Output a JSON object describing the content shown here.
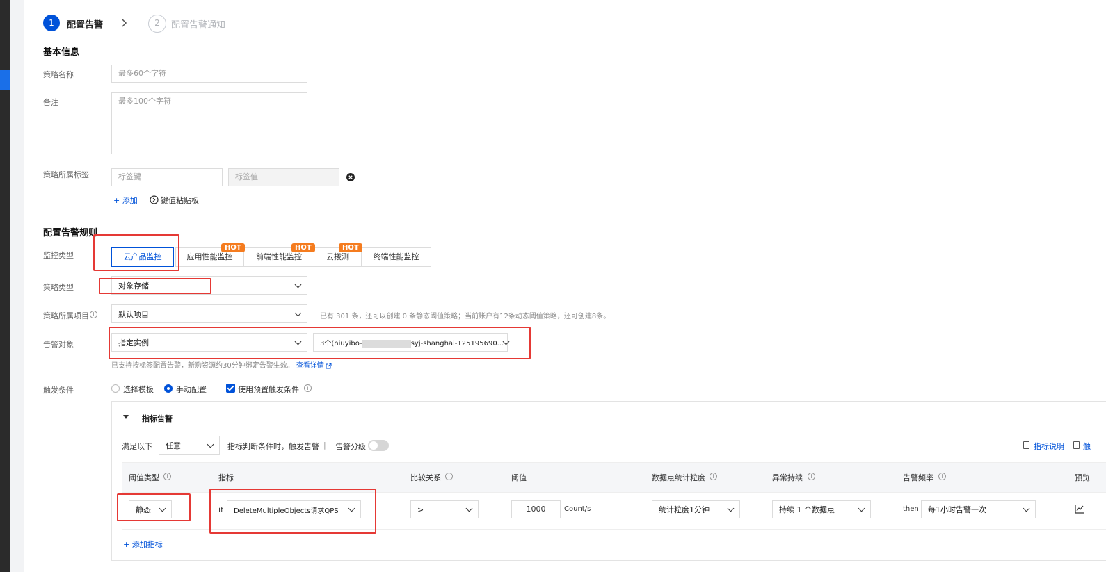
{
  "steps": [
    {
      "num": "1",
      "label": "配置告警"
    },
    {
      "num": "2",
      "label": "配置告警通知"
    }
  ],
  "basic_info": {
    "title": "基本信息",
    "name_label": "策略名称",
    "name_placeholder": "最多60个字符",
    "remark_label": "备注",
    "remark_placeholder": "最多100个字符",
    "tags_label": "策略所属标签",
    "tag_key_placeholder": "标签键",
    "tag_value_placeholder": "标签值",
    "add_label": "+ 添加",
    "paste_label": "键值粘贴板"
  },
  "rules": {
    "title": "配置告警规则",
    "monitor_type_label": "监控类型",
    "monitor_tabs": [
      {
        "label": "云产品监控",
        "hot": ""
      },
      {
        "label": "应用性能监控",
        "hot": "HOT"
      },
      {
        "label": "前端性能监控",
        "hot": "HOT"
      },
      {
        "label": "云拨测",
        "hot": "HOT"
      },
      {
        "label": "终端性能监控",
        "hot": ""
      }
    ],
    "policy_type_label": "策略类型",
    "policy_type_value": "对象存储",
    "project_label": "策略所属项目",
    "project_value": "默认项目",
    "project_note": "已有 301 条，还可以创建 0 条静态阈值策略；当前账户有12条动态阈值策略，还可创建8条。",
    "target_label": "告警对象",
    "target_value": "指定实例",
    "instance_prefix": "3个(niuyibo-",
    "instance_suffix": "syj-shanghai-125195690...",
    "target_note": "已支持按标签配置告警，新购资源约30分钟绑定告警生效。",
    "target_link": "查看详情",
    "trigger_label": "触发条件",
    "trigger_options": {
      "template": "选择模板",
      "manual": "手动配置",
      "preset": "使用预置触发条件"
    }
  },
  "metric_panel": {
    "title": "指标告警",
    "satisfy_label": "满足以下",
    "satisfy_value": "任意",
    "satisfy_suffix": "指标判断条件时，触发告警",
    "separator": "|",
    "level_label": "告警分级",
    "doc_link1": "指标说明",
    "doc_link2": "触",
    "headers": {
      "threshold_type": "阈值类型",
      "metric": "指标",
      "compare": "比较关系",
      "threshold": "阈值",
      "granularity": "数据点统计粒度",
      "duration": "异常持续",
      "frequency": "告警频率",
      "preview": "预览"
    },
    "row": {
      "threshold_type": "静态",
      "if_label": "if",
      "metric": "DeleteMultipleObjects请求QPS",
      "compare": ">",
      "threshold": "1000",
      "unit": "Count/s",
      "granularity": "统计粒度1分钟",
      "duration": "持续 1 个数据点",
      "then_label": "then",
      "frequency": "每1小时告警一次"
    },
    "add_metric": "+ 添加指标"
  }
}
